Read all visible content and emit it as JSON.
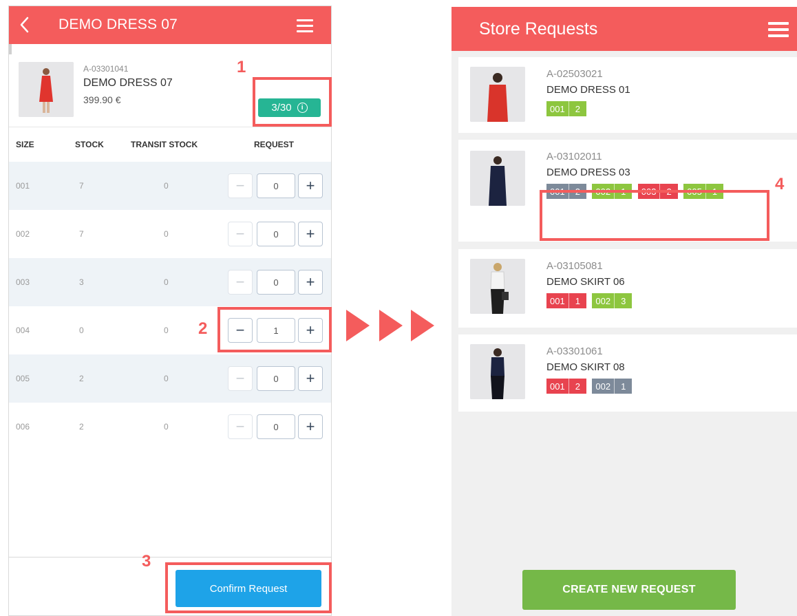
{
  "detail_screen": {
    "title": "DEMO DRESS 07",
    "product": {
      "code": "A-03301041",
      "name": "DEMO DRESS 07",
      "price": "399.90 €",
      "quota": "3/30",
      "quota_icon": "info-icon"
    },
    "columns": [
      "SIZE",
      "STOCK",
      "TRANSIT STOCK",
      "REQUEST"
    ],
    "rows": [
      {
        "size": "001",
        "stock": "7",
        "transit": "0",
        "request": "0"
      },
      {
        "size": "002",
        "stock": "7",
        "transit": "0",
        "request": "0"
      },
      {
        "size": "003",
        "stock": "3",
        "transit": "0",
        "request": "0"
      },
      {
        "size": "004",
        "stock": "0",
        "transit": "0",
        "request": "1"
      },
      {
        "size": "005",
        "stock": "2",
        "transit": "0",
        "request": "0"
      },
      {
        "size": "006",
        "stock": "2",
        "transit": "0",
        "request": "0"
      }
    ],
    "stepper_minus": "−",
    "stepper_plus": "+",
    "confirm_label": "Confirm Request"
  },
  "store_requests": {
    "title": "Store Requests",
    "items": [
      {
        "code": "A-02503021",
        "name": "DEMO DRESS 01",
        "tags": [
          {
            "size": "001",
            "qty": "2",
            "status": "green"
          }
        ]
      },
      {
        "code": "A-03102011",
        "name": "DEMO DRESS 03",
        "tags": [
          {
            "size": "001",
            "qty": "2",
            "status": "gray"
          },
          {
            "size": "002",
            "qty": "1",
            "status": "green"
          },
          {
            "size": "003",
            "qty": "2",
            "status": "red"
          },
          {
            "size": "005",
            "qty": "1",
            "status": "green"
          }
        ]
      },
      {
        "code": "A-03105081",
        "name": "DEMO SKIRT 06",
        "tags": [
          {
            "size": "001",
            "qty": "1",
            "status": "red"
          },
          {
            "size": "002",
            "qty": "3",
            "status": "green"
          }
        ]
      },
      {
        "code": "A-03301061",
        "name": "DEMO SKIRT 08",
        "tags": [
          {
            "size": "001",
            "qty": "2",
            "status": "red"
          },
          {
            "size": "002",
            "qty": "1",
            "status": "gray"
          }
        ]
      }
    ],
    "create_label": "CREATE NEW REQUEST"
  },
  "annotations": {
    "n1": "1",
    "n2": "2",
    "n3": "3",
    "n4": "4"
  },
  "colors": {
    "brand_red": "#f45c5c",
    "quota_green": "#26b594",
    "confirm_blue": "#1ea3e8",
    "create_green": "#75b848",
    "tag_green": "#8dc63f",
    "tag_red": "#e8434f",
    "tag_gray": "#7d8a9a"
  }
}
